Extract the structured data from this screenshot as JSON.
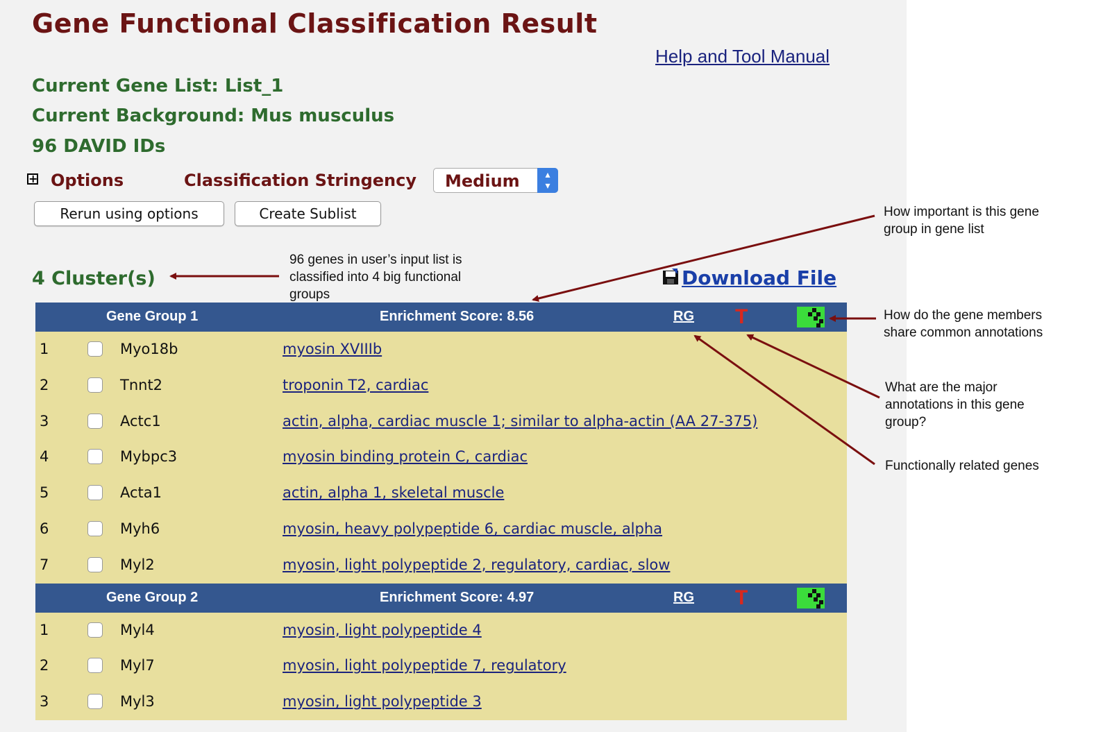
{
  "page": {
    "title": "Gene Functional Classification Result",
    "help_link": "Help and Tool Manual",
    "current_gene_list": "Current Gene List: List_1",
    "current_background": "Current Background: Mus musculus",
    "david_ids": "96 DAVID IDs"
  },
  "options": {
    "options_label": "Options",
    "stringency_label": "Classification Stringency",
    "stringency_value": "Medium",
    "rerun_button": "Rerun using options",
    "sublist_button": "Create Sublist"
  },
  "results": {
    "cluster_count": "4 Cluster(s)",
    "download_label": "Download File"
  },
  "groups": [
    {
      "name": "Gene Group 1",
      "score": "Enrichment Score: 8.56",
      "rg": "RG",
      "t": "T",
      "rows": [
        {
          "num": "1",
          "gene": "Myo18b",
          "desc": "myosin XVIIIb"
        },
        {
          "num": "2",
          "gene": "Tnnt2",
          "desc": "troponin T2, cardiac"
        },
        {
          "num": "3",
          "gene": "Actc1",
          "desc": "actin, alpha, cardiac muscle 1; similar to alpha-actin (AA 27-375)"
        },
        {
          "num": "4",
          "gene": "Mybpc3",
          "desc": "myosin binding protein C, cardiac"
        },
        {
          "num": "5",
          "gene": "Acta1",
          "desc": "actin, alpha 1, skeletal muscle"
        },
        {
          "num": "6",
          "gene": "Myh6",
          "desc": "myosin, heavy polypeptide 6, cardiac muscle, alpha"
        },
        {
          "num": "7",
          "gene": "Myl2",
          "desc": "myosin, light polypeptide 2, regulatory, cardiac, slow"
        }
      ]
    },
    {
      "name": "Gene Group 2",
      "score": "Enrichment Score: 4.97",
      "rg": "RG",
      "t": "T",
      "rows": [
        {
          "num": "1",
          "gene": "Myl4",
          "desc": "myosin, light polypeptide 4"
        },
        {
          "num": "2",
          "gene": "Myl7",
          "desc": "myosin, light polypeptide 7, regulatory"
        },
        {
          "num": "3",
          "gene": "Myl3",
          "desc": "myosin, light polypeptide 3"
        }
      ]
    }
  ],
  "annotations": {
    "input_list": [
      "96 genes in user’s input list is",
      "classified into 4 big functional",
      "groups"
    ],
    "importance": [
      "How important is this gene",
      "group in gene list"
    ],
    "share": [
      "How do the gene members",
      "share common annotations"
    ],
    "major": [
      "What are the major",
      "annotations in this gene",
      "group?"
    ],
    "related": [
      "Functionally related genes"
    ]
  },
  "colors": {
    "title": "#6b1414",
    "info_green": "#2e6b2e",
    "group_header": "#34578f",
    "row_bg": "#e8df9e",
    "link": "#1a237e",
    "arrow": "#7a0f0f"
  }
}
